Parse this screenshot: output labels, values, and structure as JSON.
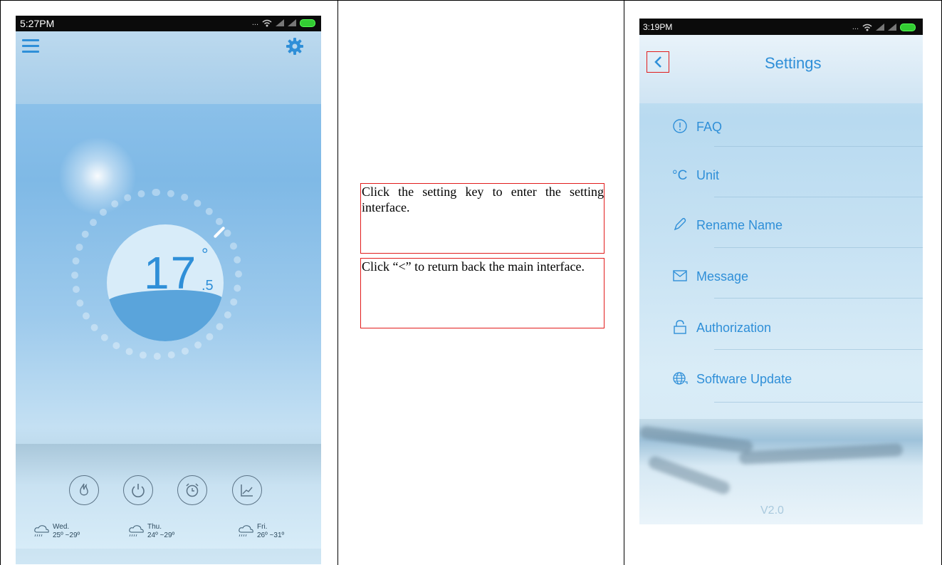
{
  "left_phone": {
    "status_time": "5:27PM",
    "status_dots": "...",
    "temperature": {
      "whole": "17",
      "degree_symbol": "°",
      "decimal": ".5"
    },
    "controls": [
      {
        "icon": "flame-icon"
      },
      {
        "icon": "power-icon"
      },
      {
        "icon": "alarm-clock-icon"
      },
      {
        "icon": "chart-icon"
      }
    ],
    "forecast": [
      {
        "day": "Wed.",
        "range": "25º ~29º",
        "icon": "cloud-rain-icon"
      },
      {
        "day": "Thu.",
        "range": "24º ~29º",
        "icon": "cloud-rain-icon"
      },
      {
        "day": "Fri.",
        "range": "26º ~31º",
        "icon": "cloud-rain-icon"
      }
    ]
  },
  "instructions": [
    "Click the setting key to enter the setting interface.",
    "Click “<” to return back the main interface."
  ],
  "right_phone": {
    "status_time": "3:19PM",
    "status_dots": "...",
    "title": "Settings",
    "menu": [
      {
        "label": "FAQ",
        "icon": "info-circle-icon"
      },
      {
        "label": "Unit",
        "icon": "celsius-icon",
        "icon_text": "°C"
      },
      {
        "label": "Rename Name",
        "icon": "pencil-icon"
      },
      {
        "label": "Message",
        "icon": "envelope-icon"
      },
      {
        "label": "Authorization",
        "icon": "lock-icon"
      },
      {
        "label": "Software Update",
        "icon": "globe-icon"
      }
    ],
    "version": "V2.0"
  },
  "colors": {
    "accent_blue": "#2f8fd8",
    "highlight_red": "#e21c1c"
  }
}
